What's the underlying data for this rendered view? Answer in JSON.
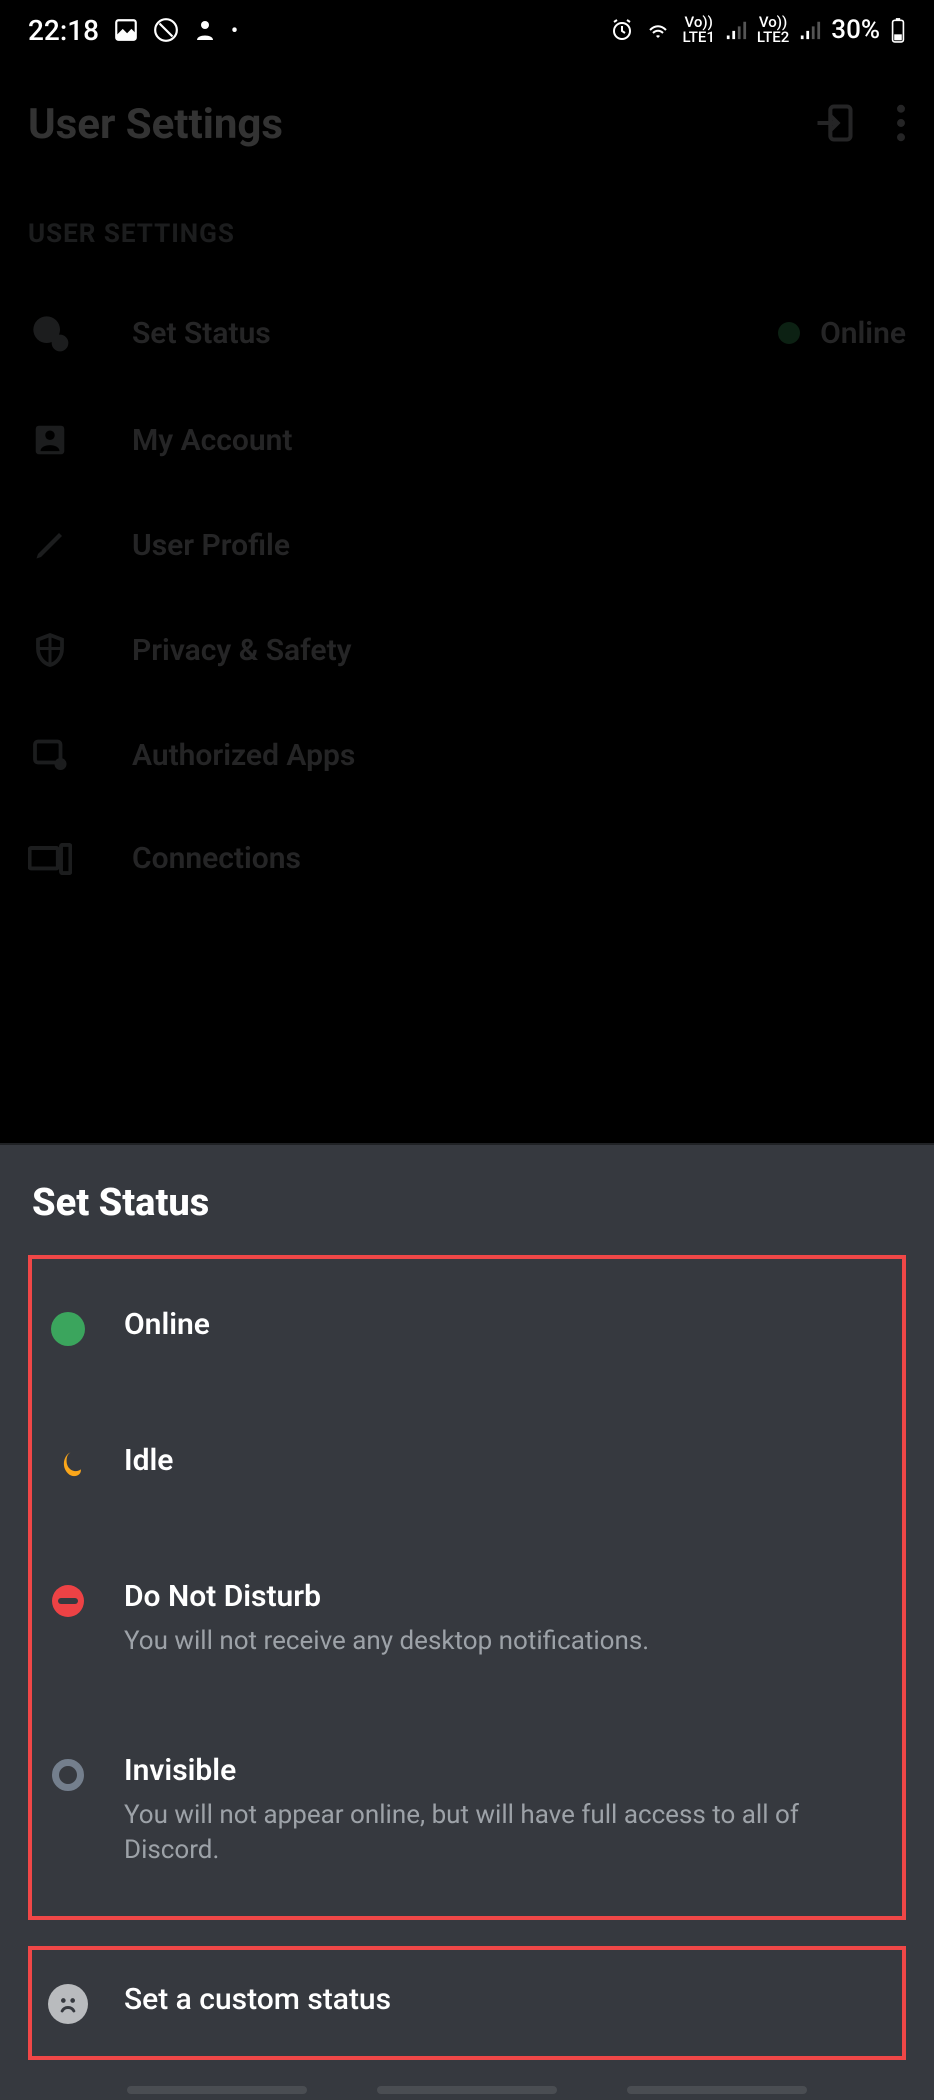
{
  "statusbar": {
    "time": "22:18",
    "battery": "30%",
    "lte1": "LTE1",
    "lte2": "LTE2",
    "vo": "Vo))"
  },
  "header": {
    "title": "User Settings"
  },
  "section_label": "USER SETTINGS",
  "menu": {
    "items": [
      {
        "label": "Set Status",
        "status": "Online"
      },
      {
        "label": "My Account"
      },
      {
        "label": "User Profile"
      },
      {
        "label": "Privacy & Safety"
      },
      {
        "label": "Authorized Apps"
      },
      {
        "label": "Connections"
      }
    ]
  },
  "sheet": {
    "title": "Set Status",
    "options": [
      {
        "label": "Online"
      },
      {
        "label": "Idle"
      },
      {
        "label": "Do Not Disturb",
        "sub": "You will not receive any desktop notifications."
      },
      {
        "label": "Invisible",
        "sub": "You will not appear online, but will have full access to all of Discord."
      }
    ],
    "custom": {
      "label": "Set a custom status"
    }
  }
}
